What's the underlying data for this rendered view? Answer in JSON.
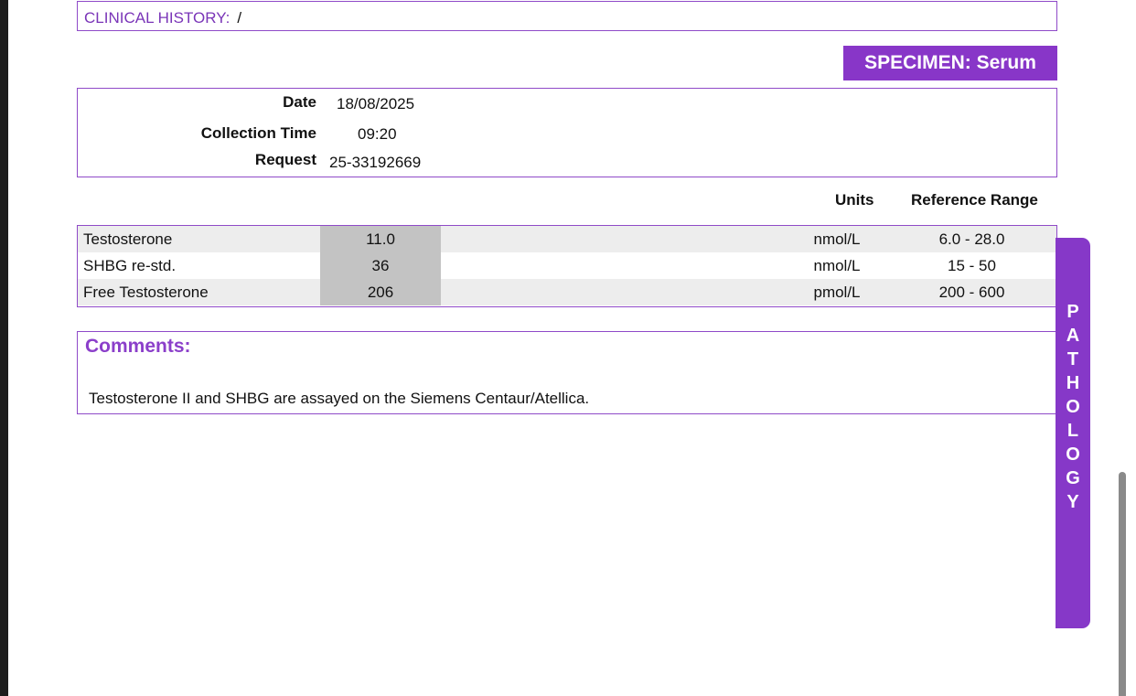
{
  "clinical_history": {
    "label": "CLINICAL HISTORY:",
    "value": "/"
  },
  "specimen": "SPECIMEN: Serum",
  "info": {
    "date_label": "Date",
    "date_value": "18/08/2025",
    "time_label": "Collection Time",
    "time_value": "09:20",
    "request_label": "Request",
    "request_value": "25-33192669"
  },
  "columns": {
    "units": "Units",
    "reference": "Reference Range"
  },
  "results": [
    {
      "name": "Testosterone",
      "value": "11.0",
      "units": "nmol/L",
      "range": "6.0 - 28.0"
    },
    {
      "name": "SHBG re-std.",
      "value": "36",
      "units": "nmol/L",
      "range": "15 - 50"
    },
    {
      "name": "Free Testosterone",
      "value": "206",
      "units": "pmol/L",
      "range": "200 - 600"
    }
  ],
  "comments": {
    "title": "Comments:",
    "text": "Testosterone II and SHBG are assayed on the Siemens Centaur/Atellica."
  },
  "side_tab": {
    "letters": [
      "P",
      "A",
      "T",
      "H",
      "O",
      "L",
      "O",
      "G",
      "Y"
    ]
  },
  "colors": {
    "accent": "#8836c8",
    "result_cell": "#c3c3c3",
    "row_shade": "#ededed"
  }
}
